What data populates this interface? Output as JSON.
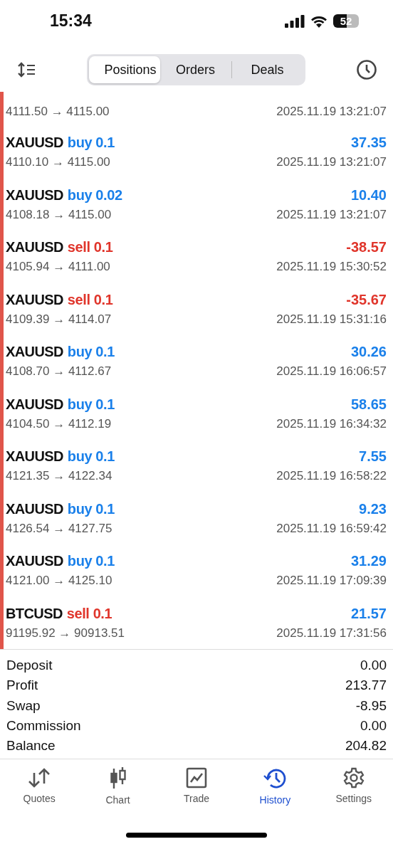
{
  "status_bar": {
    "time": "15:34",
    "battery": "52"
  },
  "tabs": [
    {
      "label": "Positions",
      "selected": true
    },
    {
      "label": "Orders",
      "selected": false
    },
    {
      "label": "Deals",
      "selected": false
    }
  ],
  "partial_row": {
    "prices": "4111.50 → 4115.00",
    "time": "2025.11.19 13:21:07"
  },
  "deals": [
    {
      "symbol": "XAUUSD",
      "kind": "buy",
      "side": "buy 0.1",
      "profit": "37.35",
      "loss": false,
      "prices": "4110.10 → 4115.00",
      "time": "2025.11.19 13:21:07"
    },
    {
      "symbol": "XAUUSD",
      "kind": "buy",
      "side": "buy 0.02",
      "profit": "10.40",
      "loss": false,
      "prices": "4108.18 → 4115.00",
      "time": "2025.11.19 13:21:07"
    },
    {
      "symbol": "XAUUSD",
      "kind": "sell",
      "side": "sell 0.1",
      "profit": "-38.57",
      "loss": true,
      "prices": "4105.94 → 4111.00",
      "time": "2025.11.19 15:30:52"
    },
    {
      "symbol": "XAUUSD",
      "kind": "sell",
      "side": "sell 0.1",
      "profit": "-35.67",
      "loss": true,
      "prices": "4109.39 → 4114.07",
      "time": "2025.11.19 15:31:16"
    },
    {
      "symbol": "XAUUSD",
      "kind": "buy",
      "side": "buy 0.1",
      "profit": "30.26",
      "loss": false,
      "prices": "4108.70 → 4112.67",
      "time": "2025.11.19 16:06:57"
    },
    {
      "symbol": "XAUUSD",
      "kind": "buy",
      "side": "buy 0.1",
      "profit": "58.65",
      "loss": false,
      "prices": "4104.50 → 4112.19",
      "time": "2025.11.19 16:34:32"
    },
    {
      "symbol": "XAUUSD",
      "kind": "buy",
      "side": "buy 0.1",
      "profit": "7.55",
      "loss": false,
      "prices": "4121.35 → 4122.34",
      "time": "2025.11.19 16:58:22"
    },
    {
      "symbol": "XAUUSD",
      "kind": "buy",
      "side": "buy 0.1",
      "profit": "9.23",
      "loss": false,
      "prices": "4126.54 → 4127.75",
      "time": "2025.11.19 16:59:42"
    },
    {
      "symbol": "XAUUSD",
      "kind": "buy",
      "side": "buy 0.1",
      "profit": "31.29",
      "loss": false,
      "prices": "4121.00 → 4125.10",
      "time": "2025.11.19 17:09:39"
    },
    {
      "symbol": "BTCUSD",
      "kind": "sell",
      "side": "sell 0.1",
      "profit": "21.57",
      "loss": false,
      "prices": "91195.92 → 90913.51",
      "time": "2025.11.19 17:31:56"
    }
  ],
  "summary": [
    {
      "label": "Deposit",
      "value": "0.00"
    },
    {
      "label": "Profit",
      "value": "213.77"
    },
    {
      "label": "Swap",
      "value": "-8.95"
    },
    {
      "label": "Commission",
      "value": "0.00"
    },
    {
      "label": "Balance",
      "value": "204.82"
    }
  ],
  "nav": [
    {
      "label": "Quotes",
      "kind": "quotes",
      "selected": false
    },
    {
      "label": "Chart",
      "kind": "chart",
      "selected": false
    },
    {
      "label": "Trade",
      "kind": "trade",
      "selected": false
    },
    {
      "label": "History",
      "kind": "history",
      "selected": true
    },
    {
      "label": "Settings",
      "kind": "settings",
      "selected": false
    }
  ]
}
